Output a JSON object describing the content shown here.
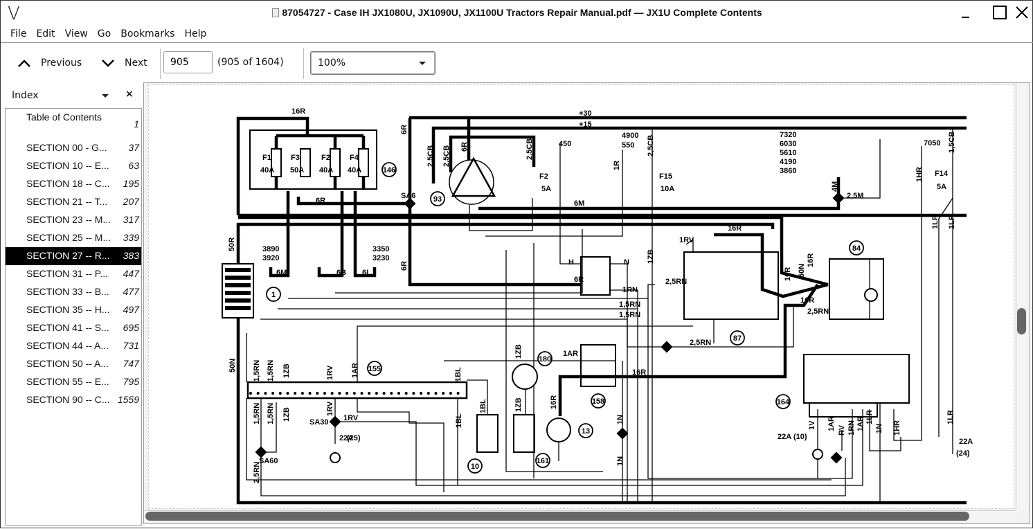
{
  "window": {
    "title": "87054727 - Case IH JX1080U, JX1090U, JX1100U Tractors Repair Manual.pdf — JX1U Complete Contents",
    "logo": "V"
  },
  "menu": [
    "File",
    "Edit",
    "View",
    "Go",
    "Bookmarks",
    "Help"
  ],
  "toolbar": {
    "previous": "Previous",
    "next": "Next",
    "page_value": "905",
    "page_count": "(905 of 1604)",
    "zoom": "100%"
  },
  "sidebar": {
    "title": "Index",
    "items": [
      {
        "label": "Table of Contents",
        "page": "1"
      },
      {
        "label": "SECTION 00 - G...",
        "page": "37"
      },
      {
        "label": "SECTION 10 -- E...",
        "page": "63"
      },
      {
        "label": "SECTION 18 -- C...",
        "page": "195"
      },
      {
        "label": "SECTION 21 -- T...",
        "page": "207"
      },
      {
        "label": "SECTION 23 -- M...",
        "page": "317"
      },
      {
        "label": "SECTION 25 -- M...",
        "page": "339"
      },
      {
        "label": "SECTION 27 -- R...",
        "page": "383",
        "selected": true
      },
      {
        "label": "SECTION 31 -- P...",
        "page": "447"
      },
      {
        "label": "SECTION 33 -- B...",
        "page": "477"
      },
      {
        "label": "SECTION 35 -- H...",
        "page": "497"
      },
      {
        "label": "SECTION 41 -- S...",
        "page": "695"
      },
      {
        "label": "SECTION 44 -- A...",
        "page": "731"
      },
      {
        "label": "SECTION 50 -- A...",
        "page": "747"
      },
      {
        "label": "SECTION 55 -- E...",
        "page": "795"
      },
      {
        "label": "SECTION 90 -- C...",
        "page": "1559"
      }
    ]
  },
  "diagram": {
    "components": [
      "146",
      "93",
      "1",
      "155",
      "180",
      "158",
      "13",
      "10",
      "161",
      "87",
      "84",
      "164"
    ],
    "labels": [
      "16R",
      "+30",
      "+15",
      "6R",
      "2,5CB",
      "2,5CB",
      "6R",
      "2,5CB",
      "450",
      "4900",
      "550",
      "2,5CB",
      "F2",
      "5A",
      "F15",
      "10A",
      "7320",
      "6030",
      "5610",
      "4190",
      "3860",
      "7050",
      "1,5CB",
      "F14",
      "5A",
      "1HR",
      "4M",
      "2,5M",
      "6M",
      "F1",
      "40A",
      "F3",
      "50A",
      "F2",
      "40A",
      "F4",
      "40A",
      "SA6",
      "6R",
      "50R",
      "3890",
      "3920",
      "6M",
      "6B",
      "3350",
      "3230",
      "6L",
      "6R",
      "1R",
      "1RV",
      "H",
      "N",
      "6R",
      "1RN",
      "2,5RN",
      "1,5RN",
      "1,5RN",
      "1ZB",
      "16R",
      "50N",
      "16R",
      "16R",
      "16R",
      "2,5RN",
      "2,5RN",
      "1LR",
      "1LR",
      "50N",
      "1,5RN",
      "1,5RN",
      "1ZB",
      "1RV",
      "1AR",
      "1BL",
      "1,5RN",
      "1,5RN",
      "1ZB",
      "1RV",
      "SA30",
      "1RV",
      "22A",
      "(25)",
      "SA60",
      "2,5RN",
      "1BL",
      "1BL",
      "1ZB",
      "1ZB",
      "1AR",
      "16R",
      "16R",
      "1N",
      "1N",
      "1V",
      "22A",
      "(10)",
      "1AR",
      "RV",
      "1RN",
      "1AR",
      "1LR",
      "1N",
      "1HR",
      "1LR",
      "22A",
      "(24)"
    ],
    "colors": {
      "line": "#000000",
      "paper": "#ffffff"
    }
  }
}
